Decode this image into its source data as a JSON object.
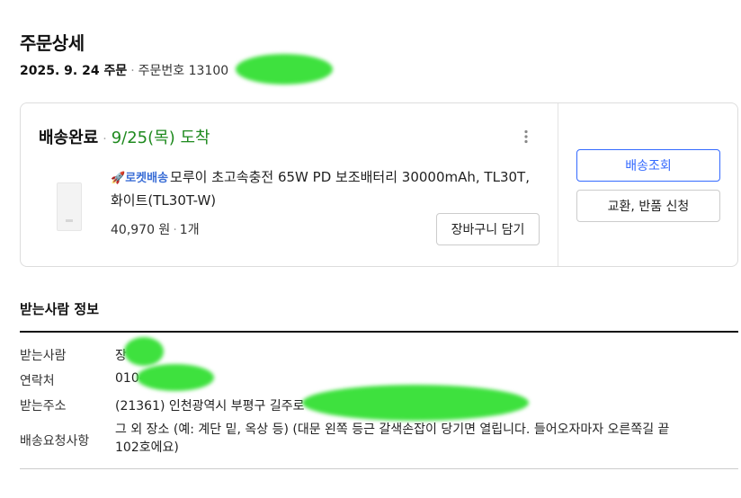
{
  "page": {
    "title": "주문상세"
  },
  "order": {
    "date": "2025. 9. 24 주문",
    "separator": "·",
    "number_prefix": "주문번호 13100"
  },
  "shipment": {
    "status": "배송완료",
    "separator": "·",
    "arrival": "9/25(목) 도착",
    "more_icon": "more-vertical-icon",
    "product": {
      "badge_icon": "rocket-icon",
      "badge": "로켓배송",
      "name": "모루이 초고속충전 65W PD 보조배터리 30000mAh, TL30T, 화이트(TL30T-W)",
      "price": "40,970 원",
      "qty_separator": "·",
      "quantity": "1개"
    },
    "cart_button": "장바구니 담기",
    "track_button": "배송조회",
    "return_button": "교환, 반품 신청"
  },
  "recipient": {
    "section_title": "받는사람 정보",
    "name_label": "받는사람",
    "name_value": "장",
    "phone_label": "연락처",
    "phone_value": "010-",
    "address_label": "받는주소",
    "address_value": "(21361) 인천광역시 부평구 길주로",
    "request_label": "배송요청사항",
    "request_value": "그 외 장소 (예: 계단 밑, 옥상 등) (대문 왼쪽 등근 갈색손잡이 당기면 열립니다. 들어오자마자 오른쪽길 끝 102호에요)"
  },
  "colors": {
    "accent": "#346aff",
    "arrival": "#1f8a1f",
    "rocket": "#3b6ed6",
    "redaction": "#3ee13e"
  }
}
